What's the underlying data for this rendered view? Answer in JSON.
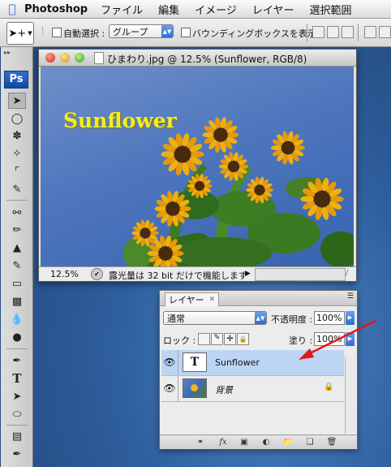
{
  "menubar": {
    "app_name": "Photoshop",
    "items": [
      "ファイル",
      "編集",
      "イメージ",
      "レイヤー",
      "選択範囲"
    ]
  },
  "options_bar": {
    "auto_select_label": "自動選択 :",
    "auto_select_value": "グループ",
    "bounding_box_label": "バウンディングボックスを表示"
  },
  "toolbox": {
    "logo": "Ps"
  },
  "document": {
    "title": "ひまわり.jpg @ 12.5% (Sunflower, RGB/8)",
    "canvas_text": "Sunflower",
    "zoom": "12.5%",
    "status_message": "露光量は 32 bit だけで機能します"
  },
  "layers_panel": {
    "tab_label": "レイヤー",
    "blend_mode": "通常",
    "opacity_label": "不透明度 :",
    "opacity_value": "100%",
    "lock_label": "ロック :",
    "fill_label": "塗り :",
    "fill_value": "100%",
    "layers": [
      {
        "name": "Sunflower",
        "type_glyph": "T",
        "selected": true
      },
      {
        "name": "背景",
        "selected": false
      }
    ]
  },
  "colors": {
    "selection_highlight": "#bcd5f5",
    "annotation_arrow": "#e01818",
    "canvas_text_color": "#f5ef1a",
    "ps_logo_blue": "#1f5cb8"
  }
}
